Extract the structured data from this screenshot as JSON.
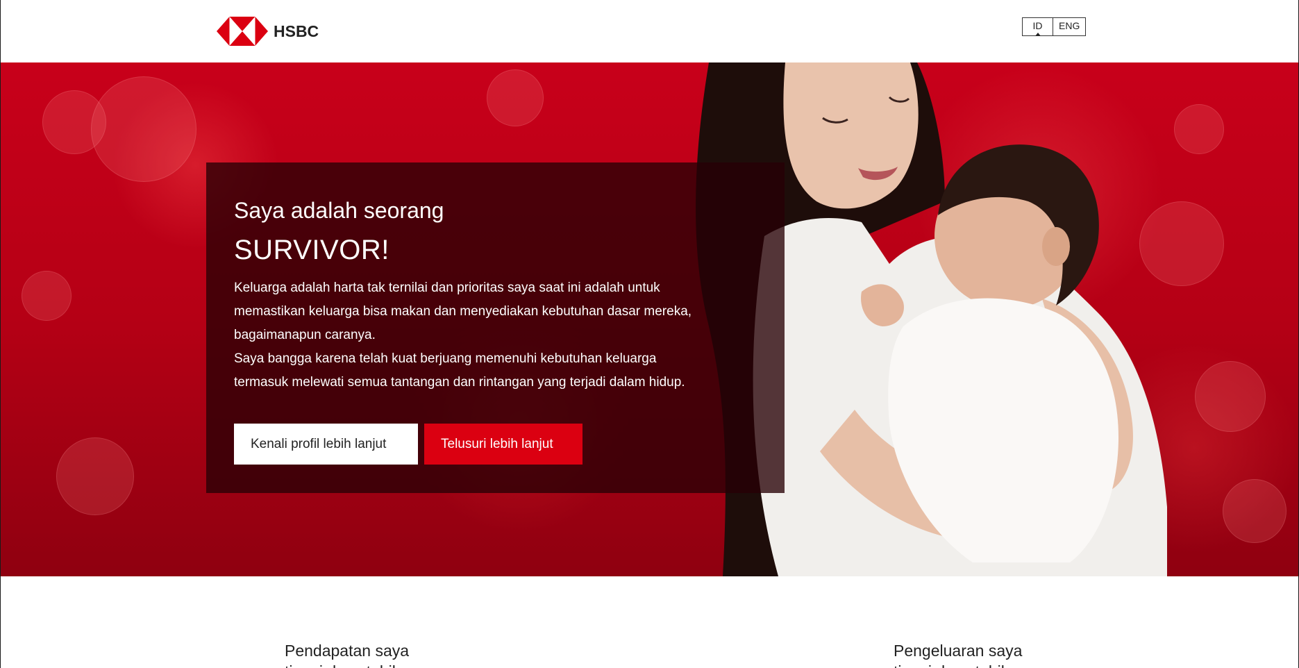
{
  "header": {
    "brand": "HSBC",
    "language": {
      "options": [
        "ID",
        "ENG"
      ],
      "selected": "ID"
    }
  },
  "hero": {
    "subtitle": "Saya adalah seorang",
    "title": "SURVIVOR!",
    "body_lines": [
      "Keluarga adalah harta tak ternilai dan prioritas saya saat ini adalah untuk",
      "memastikan keluarga bisa makan dan menyediakan kebutuhan dasar mereka,",
      "bagaimanapun caranya.",
      "Saya bangga karena telah kuat berjuang memenuhi kebutuhan keluarga",
      "termasuk melewati semua tantangan dan rintangan yang terjadi dalam hidup."
    ],
    "primary_button": "Kenali profil lebih lanjut",
    "secondary_button": "Telusuri lebih lanjut"
  },
  "sections": {
    "left": {
      "title": "Pendapatan saya",
      "next_line_partial": "tinggi dan stabil"
    },
    "right": {
      "title": "Pengeluaran saya",
      "next_line_partial": "tinggi dan stabil"
    }
  },
  "colors": {
    "brand_red": "#db0011",
    "hero_bg": "#c8001a",
    "card_bg": "#280005"
  },
  "icons": {
    "logo": "hsbc-hexagon-logo"
  }
}
